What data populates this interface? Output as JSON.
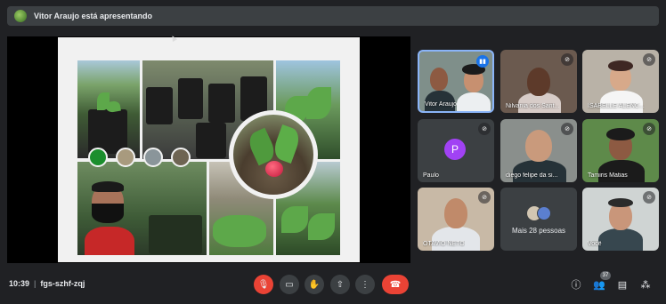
{
  "banner": {
    "presenter_text": "Vitor Araujo está apresentando",
    "avatar": "presenter-avatar"
  },
  "slide": {
    "swatch_colors": [
      "#1b8e2d",
      "#a89a7e",
      "#8a959a",
      "#6e6452"
    ]
  },
  "participants": [
    {
      "name": "Vitor Araujo",
      "mic": "speaking-icon",
      "active": true
    },
    {
      "name": "Nilvania dos Sant...",
      "mic": "mic-off-icon"
    },
    {
      "name": "ISABELLE ALENC...",
      "mic": "mic-off-icon"
    },
    {
      "name": "Paulo",
      "mic": "mic-off-icon",
      "initial": "P"
    },
    {
      "name": "diego felipe da si...",
      "mic": "mic-off-icon"
    },
    {
      "name": "Tamiris Matias",
      "mic": "mic-off-icon"
    },
    {
      "name": "OTAVIO NETO",
      "mic": "mic-off-icon"
    },
    {
      "name": "Mais 28 pessoas"
    },
    {
      "name": "Você",
      "mic": "mic-off-icon"
    }
  ],
  "bottom_bar": {
    "time": "10:39",
    "separator": "|",
    "meeting_code": "fgs-szhf-zqj",
    "people_count": "37"
  },
  "icons": {
    "mic": "mic-off-icon",
    "camera": "camera-icon",
    "hand": "raise-hand-icon",
    "present": "present-icon",
    "more": "more-options-icon",
    "leave": "hang-up-icon",
    "info": "info-icon",
    "people": "people-icon",
    "chat": "chat-icon",
    "activities": "activities-icon"
  }
}
